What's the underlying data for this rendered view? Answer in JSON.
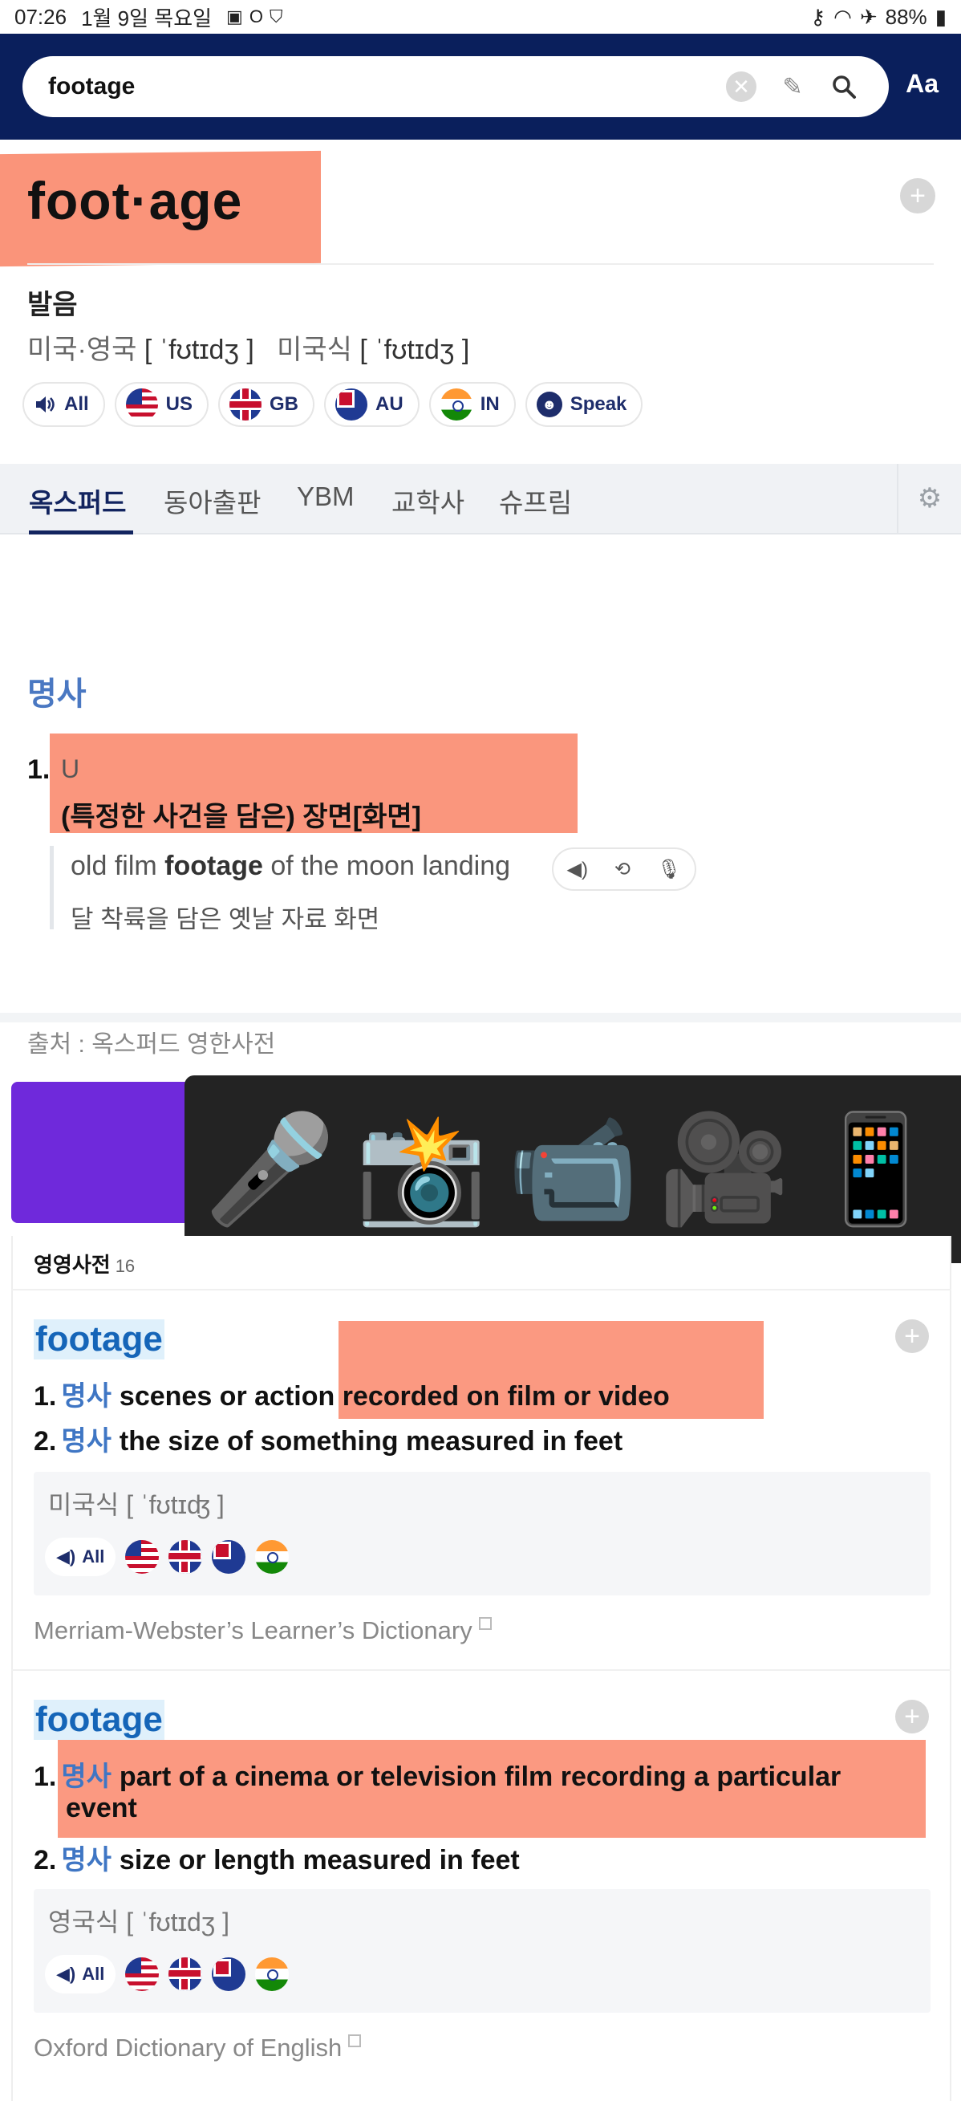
{
  "status_bar": {
    "time": "07:26",
    "date": "1월 9일 목요일",
    "battery": "88%"
  },
  "search": {
    "query": "footage",
    "font_button": "Aa"
  },
  "headword": {
    "text": "foot·age"
  },
  "pronunciation": {
    "title": "발음",
    "us_gb_label": "미국·영국",
    "us_gb_ipa": "[ ˈfʊtɪdʒ ]",
    "us_label": "미국식",
    "us_ipa": "[ ˈfʊtɪdʒ ]",
    "chips": [
      "All",
      "US",
      "GB",
      "AU",
      "IN",
      "Speak"
    ]
  },
  "tabs": {
    "items": [
      "옥스퍼드",
      "동아출판",
      "YBM",
      "교학사",
      "슈프림"
    ],
    "active": "옥스퍼드"
  },
  "definition": {
    "pos": "명사",
    "sense_number": "1.",
    "grammar": "U",
    "meaning": "(특정한 사건을 담은) 장면[화면]",
    "example_pre": "old film ",
    "example_bold": "footage",
    "example_post": " of the moon landing",
    "example_ko": "달 착륙을 담은 옛날 자료 화면"
  },
  "source": "출처 : 옥스퍼드 영한사전",
  "emoji_panel": {
    "items": [
      "microphone",
      "camera with flash",
      "video camera",
      "movie camera",
      "mobile phone"
    ],
    "glyphs": [
      "🎤",
      "📸",
      "📹",
      "🎥",
      "📱"
    ]
  },
  "english_dict": {
    "title": "영영사전",
    "count": "16",
    "entries": [
      {
        "word": "footage",
        "defs": [
          {
            "num": "1.",
            "pos": "명사",
            "text": "scenes or action recorded on film or video"
          },
          {
            "num": "2.",
            "pos": "명사",
            "text": "the size of something measured in feet"
          }
        ],
        "ipa": "미국식 [ ˈfʊtɪʤ ]",
        "all_label": "All",
        "source": "Merriam-Webster’s Learner’s Dictionary"
      },
      {
        "word": "footage",
        "defs": [
          {
            "num": "1.",
            "pos": "명사",
            "text": "part of a cinema or television film recording a particular",
            "text2": "event"
          },
          {
            "num": "2.",
            "pos": "명사",
            "text": "size or length measured in feet"
          }
        ],
        "ipa": "영국식 [ ˈfʊtɪdʒ ]",
        "all_label": "All",
        "source": "Oxford Dictionary of English"
      }
    ]
  },
  "colors": {
    "header_bg": "#0a1f5c",
    "highlight": "#fa8b6f",
    "pos_blue": "#3f76c4",
    "word_blue": "#1565b8",
    "banner_purple": "#6f29db"
  }
}
